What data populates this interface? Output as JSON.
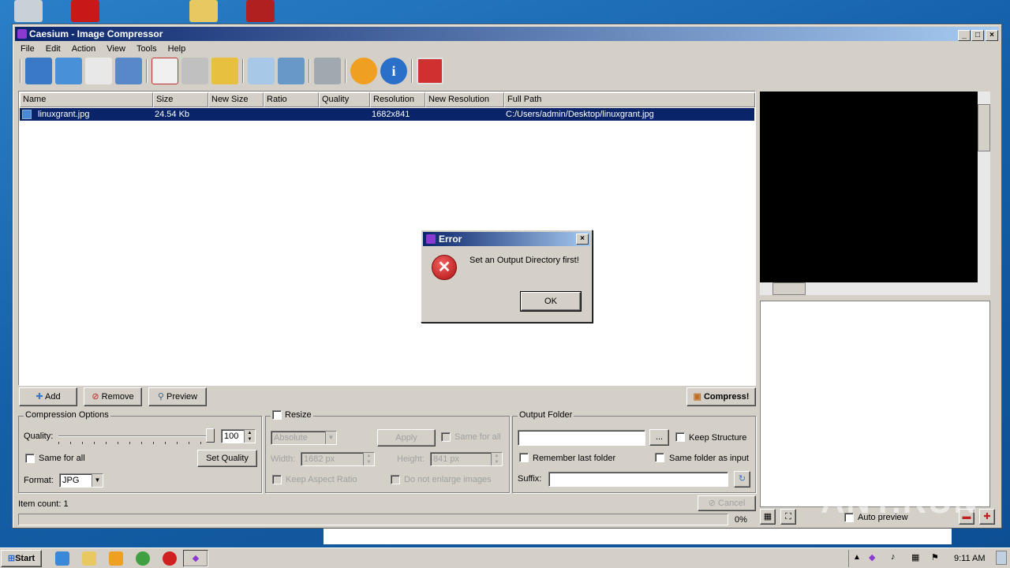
{
  "window": {
    "title": "Caesium - Image Compressor"
  },
  "menu": [
    "File",
    "Edit",
    "Action",
    "View",
    "Tools",
    "Help"
  ],
  "toolbar": [
    "open-file-icon",
    "open-folder-icon",
    "save-list-icon",
    "export-list-icon",
    "remove-item-icon",
    "clear-list-icon",
    "clean-icon",
    "search-icon",
    "preview-icon",
    "settings-icon",
    "update-icon",
    "info-icon",
    "power-icon"
  ],
  "list": {
    "columns": [
      "Name",
      "Size",
      "New Size",
      "Ratio",
      "Quality",
      "Resolution",
      "New Resolution",
      "Full Path"
    ],
    "rows": [
      {
        "name": "linuxgrant.jpg",
        "size": "24.54 Kb",
        "new_size": "",
        "ratio": "",
        "quality": "",
        "resolution": "1682x841",
        "new_resolution": "",
        "path": "C:/Users/admin/Desktop/linuxgrant.jpg"
      }
    ]
  },
  "buttons": {
    "add": "Add",
    "remove": "Remove",
    "preview": "Preview",
    "compress": "Compress!",
    "cancel": "Cancel"
  },
  "compression": {
    "title": "Compression Options",
    "quality_label": "Quality:",
    "quality_value": "100",
    "same_for_all": "Same for all",
    "set_quality": "Set Quality",
    "format_label": "Format:",
    "format_value": "JPG"
  },
  "resize": {
    "title": "Resize",
    "mode": "Absolute",
    "apply": "Apply",
    "same_for_all": "Same for all",
    "width_label": "Width:",
    "width_value": "1682 px",
    "height_label": "Height:",
    "height_value": "841 px",
    "keep_aspect": "Keep Aspect Ratio",
    "no_enlarge": "Do not enlarge images"
  },
  "output": {
    "title": "Output Folder",
    "browse": "...",
    "keep_structure": "Keep Structure",
    "remember": "Remember last folder",
    "same_folder": "Same folder as input",
    "suffix_label": "Suffix:"
  },
  "status": {
    "item_count": "Item count: 1",
    "progress": "0%",
    "progress_value": 0
  },
  "preview": {
    "auto_preview": "Auto preview"
  },
  "dialog": {
    "title": "Error",
    "message": "Set an Output Directory first!",
    "ok": "OK"
  },
  "taskbar": {
    "start": "Start",
    "time": "9:11 AM"
  },
  "watermark": "ANY.RUN"
}
